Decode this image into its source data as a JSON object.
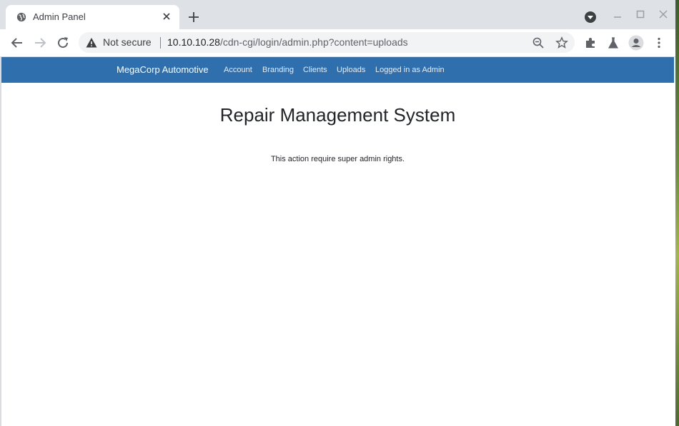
{
  "browser": {
    "tab_title": "Admin Panel",
    "not_secure_label": "Not secure",
    "url_host": "10.10.10.28",
    "url_path": "/cdn-cgi/login/admin.php?content=uploads"
  },
  "navbar": {
    "brand": "MegaCorp Automotive",
    "links": [
      "Account",
      "Branding",
      "Clients",
      "Uploads",
      "Logged in as Admin"
    ]
  },
  "main": {
    "heading": "Repair Management System",
    "message": "This action require super admin rights."
  },
  "colors": {
    "navbar": "#2f6fae",
    "tabstrip": "#dee1e6"
  }
}
